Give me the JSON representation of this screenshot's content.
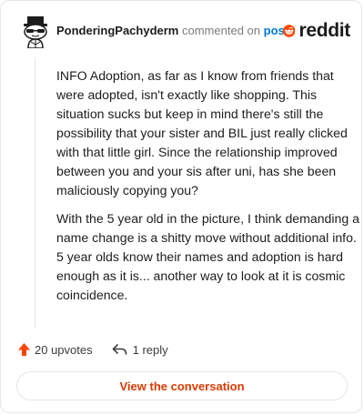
{
  "header": {
    "username": "PonderingPachyderm",
    "commented_on_text": "commented on",
    "post_link": "post",
    "brand_wordmark": "reddit",
    "avatar_icon": "snoo-avatar-icon",
    "logo_icon": "reddit-snoo-logo-icon"
  },
  "comment": {
    "paragraphs": [
      "INFO Adoption, as far as I know from friends that were adopted, isn't exactly like shopping. This situation sucks but keep in mind there's still the possibility that your sister and BIL just really clicked with that little girl. Since the relationship improved between you and your sis after uni, has she been maliciously copying you?",
      "With the 5 year old in the picture, I think demanding a name change is a shitty move without additional info. 5 year olds know their names and adoption is hard enough as it is... another way to look at it is cosmic coincidence."
    ]
  },
  "actions": {
    "upvotes": "20 upvotes",
    "replies": "1 reply",
    "upvote_icon": "upvote-arrow-icon",
    "reply_icon": "reply-arrow-icon"
  },
  "footer": {
    "view_button": "View the conversation"
  },
  "colors": {
    "brand_orange": "#ff4500",
    "link_blue": "#0079d3",
    "button_text": "#d93a00",
    "border": "#e4e6e8"
  }
}
